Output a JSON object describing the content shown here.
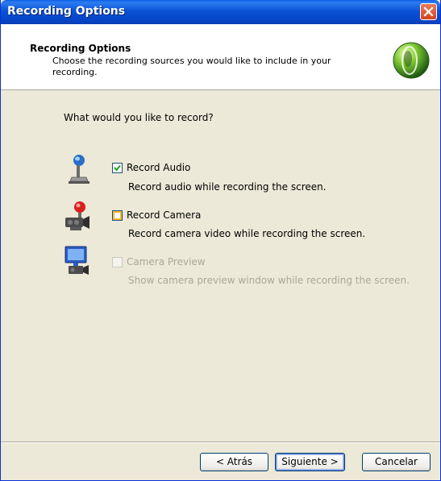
{
  "window": {
    "title": "Recording Options"
  },
  "header": {
    "title": "Recording Options",
    "subtitle": "Choose the recording sources you would like to include in your recording."
  },
  "content": {
    "question": "What would you like to record?",
    "options": [
      {
        "label": "Record Audio",
        "description": "Record audio while recording the screen.",
        "checked": true,
        "enabled": true,
        "icon": "microphone-icon"
      },
      {
        "label": "Record Camera",
        "description": "Record camera video while recording the screen.",
        "checked": false,
        "enabled": true,
        "icon": "camera-icon"
      },
      {
        "label": "Camera Preview",
        "description": "Show camera preview window while recording the screen.",
        "checked": false,
        "enabled": false,
        "icon": "monitor-camera-icon"
      }
    ]
  },
  "buttons": {
    "back": "< Atrás",
    "next": "Siguiente >",
    "cancel": "Cancelar"
  },
  "colors": {
    "titlebar": "#0953d6",
    "dialog_bg": "#ece9d8",
    "checkbox_border": "#1c5180",
    "checkbox_hover": "#f8b636",
    "check_mark": "#21a121"
  }
}
